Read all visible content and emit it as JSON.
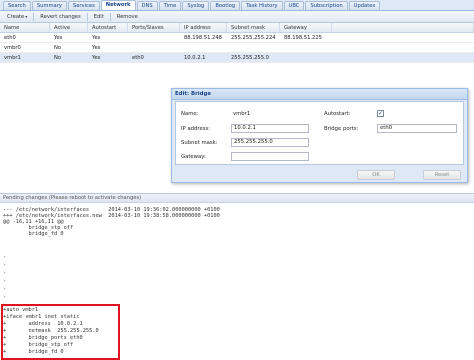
{
  "tabs": [
    "Search",
    "Summary",
    "Services",
    "Network",
    "DNS",
    "Time",
    "Syslog",
    "Bootlog",
    "Task History",
    "UBC",
    "Subscription",
    "Updates"
  ],
  "active_tab": "Network",
  "toolbar": {
    "create_label": "Create",
    "revert_label": "Revert changes",
    "edit_label": "Edit",
    "remove_label": "Remove"
  },
  "grid": {
    "columns": [
      "Name",
      "Active",
      "Autostart",
      "Ports/Slaves",
      "IP address",
      "Subnet mask",
      "Gateway"
    ],
    "rows": [
      {
        "name": "eth0",
        "active": "Yes",
        "autostart": "Yes",
        "ports": "",
        "ip": "88.198.51.248",
        "mask": "255.255.255.224",
        "gateway": "88.198.51.225"
      },
      {
        "name": "vmbr0",
        "active": "No",
        "autostart": "Yes",
        "ports": "",
        "ip": "",
        "mask": "",
        "gateway": ""
      },
      {
        "name": "vmbr1",
        "active": "No",
        "autostart": "Yes",
        "ports": "eth0",
        "ip": "10.0.2.1",
        "mask": "255.255.255.0",
        "gateway": ""
      }
    ]
  },
  "dialog": {
    "title": "Edit: Bridge",
    "name_label": "Name:",
    "name_value": "vmbr1",
    "ip_label": "IP address:",
    "ip_value": "10.0.2.1",
    "mask_label": "Subnet mask:",
    "mask_value": "255.255.255.0",
    "gateway_label": "Gateway:",
    "gateway_value": "",
    "autostart_label": "Autostart:",
    "autostart_checked": true,
    "ports_label": "Bridge ports:",
    "ports_value": "eth0",
    "ok_label": "OK",
    "reset_label": "Reset"
  },
  "pending": {
    "header": "Pending changes (Please reboot to activate changes)",
    "lines": [
      "--- /etc/network/interfaces      2014-03-10 19:36:02.000000000 +0100",
      "+++ /etc/network/interfaces.new  2014-03-10 19:38:58.000000000 +0100",
      "@@ -16,11 +16,11 @@",
      "        bridge_stp off",
      "        bridge_fd 0",
      "",
      "-",
      "-",
      "-",
      "-",
      "-",
      "-",
      "-",
      "",
      "+auto vmbr1",
      "+iface vmbr1 inet static",
      "+       address  10.0.2.1",
      "+       netmask  255.255.255.0",
      "+       bridge_ports eth0",
      "+       bridge_stp off",
      "+       bridge_fd 0"
    ]
  },
  "colors": {
    "highlight_border": "#e0141e",
    "accent": "#15428b"
  }
}
